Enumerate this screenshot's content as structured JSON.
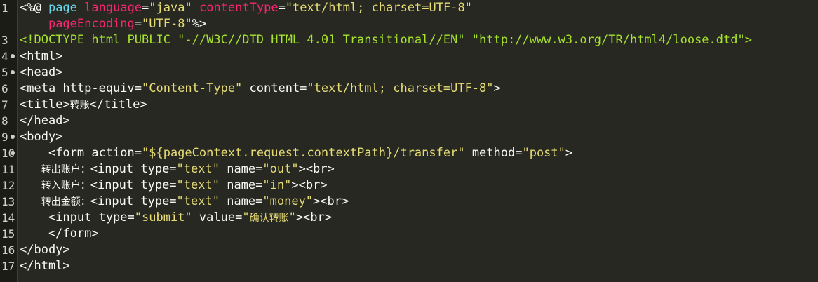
{
  "editor": {
    "colors": {
      "background": "#272822",
      "plain": "#f8f8f2",
      "directive": "#66d9ef",
      "attribute": "#f92672",
      "string": "#e6db74",
      "doctype": "#a6e22e",
      "gutter_text": "#d0d0c8"
    },
    "lines": [
      {
        "number": "1",
        "fold": false,
        "tokens": [
          {
            "text": "<%@ ",
            "kind": "plain"
          },
          {
            "text": "page",
            "kind": "directive"
          },
          {
            "text": " ",
            "kind": "plain"
          },
          {
            "text": "language",
            "kind": "attribute"
          },
          {
            "text": "=",
            "kind": "plain"
          },
          {
            "text": "\"java\"",
            "kind": "string"
          },
          {
            "text": " ",
            "kind": "plain"
          },
          {
            "text": "contentType",
            "kind": "attribute"
          },
          {
            "text": "=",
            "kind": "plain"
          },
          {
            "text": "\"text/html; charset=UTF-8\"",
            "kind": "string"
          }
        ]
      },
      {
        "number": "",
        "fold": false,
        "tokens": [
          {
            "text": "    ",
            "kind": "plain"
          },
          {
            "text": "pageEncoding",
            "kind": "attribute"
          },
          {
            "text": "=",
            "kind": "plain"
          },
          {
            "text": "\"UTF-8\"",
            "kind": "string"
          },
          {
            "text": "%>",
            "kind": "plain"
          }
        ]
      },
      {
        "number": "3",
        "fold": false,
        "tokens": [
          {
            "text": "<!DOCTYPE html PUBLIC \"-//W3C//DTD HTML 4.01 Transitional//EN\" \"http://www.w3.org/TR/html4/loose.dtd\">",
            "kind": "doctype"
          }
        ]
      },
      {
        "number": "4",
        "fold": true,
        "tokens": [
          {
            "text": "<html>",
            "kind": "plain"
          }
        ]
      },
      {
        "number": "5",
        "fold": true,
        "tokens": [
          {
            "text": "<head>",
            "kind": "plain"
          }
        ]
      },
      {
        "number": "6",
        "fold": false,
        "tokens": [
          {
            "text": "<meta http-equiv=",
            "kind": "plain"
          },
          {
            "text": "\"Content-Type\"",
            "kind": "string"
          },
          {
            "text": " content=",
            "kind": "plain"
          },
          {
            "text": "\"text/html; charset=UTF-8\"",
            "kind": "string"
          },
          {
            "text": ">",
            "kind": "plain"
          }
        ]
      },
      {
        "number": "7",
        "fold": false,
        "tokens": [
          {
            "text": "<title>",
            "kind": "plain"
          },
          {
            "text": "转账",
            "kind": "plain",
            "cjk": true
          },
          {
            "text": "</title>",
            "kind": "plain"
          }
        ]
      },
      {
        "number": "8",
        "fold": false,
        "tokens": [
          {
            "text": "</head>",
            "kind": "plain"
          }
        ]
      },
      {
        "number": "9",
        "fold": true,
        "tokens": [
          {
            "text": "<body>",
            "kind": "plain"
          }
        ]
      },
      {
        "number": "10",
        "fold": true,
        "tokens": [
          {
            "text": "    <form action=",
            "kind": "plain"
          },
          {
            "text": "\"${pageContext.request.contextPath}/transfer\"",
            "kind": "string"
          },
          {
            "text": " method=",
            "kind": "plain"
          },
          {
            "text": "\"post\"",
            "kind": "string"
          },
          {
            "text": ">",
            "kind": "plain"
          }
        ]
      },
      {
        "number": "11",
        "fold": false,
        "tokens": [
          {
            "text": "   ",
            "kind": "plain"
          },
          {
            "text": "转出账户：",
            "kind": "plain",
            "cjk": true
          },
          {
            "text": "<input type=",
            "kind": "plain"
          },
          {
            "text": "\"text\"",
            "kind": "string"
          },
          {
            "text": " name=",
            "kind": "plain"
          },
          {
            "text": "\"out\"",
            "kind": "string"
          },
          {
            "text": "><br>",
            "kind": "plain"
          }
        ]
      },
      {
        "number": "12",
        "fold": false,
        "tokens": [
          {
            "text": "   ",
            "kind": "plain"
          },
          {
            "text": "转入账户：",
            "kind": "plain",
            "cjk": true
          },
          {
            "text": "<input type=",
            "kind": "plain"
          },
          {
            "text": "\"text\"",
            "kind": "string"
          },
          {
            "text": " name=",
            "kind": "plain"
          },
          {
            "text": "\"in\"",
            "kind": "string"
          },
          {
            "text": "><br>",
            "kind": "plain"
          }
        ]
      },
      {
        "number": "13",
        "fold": false,
        "tokens": [
          {
            "text": "   ",
            "kind": "plain"
          },
          {
            "text": "转出金额：",
            "kind": "plain",
            "cjk": true
          },
          {
            "text": "<input type=",
            "kind": "plain"
          },
          {
            "text": "\"text\"",
            "kind": "string"
          },
          {
            "text": " name=",
            "kind": "plain"
          },
          {
            "text": "\"money\"",
            "kind": "string"
          },
          {
            "text": "><br>",
            "kind": "plain"
          }
        ]
      },
      {
        "number": "14",
        "fold": false,
        "tokens": [
          {
            "text": "    <input type=",
            "kind": "plain"
          },
          {
            "text": "\"submit\"",
            "kind": "string"
          },
          {
            "text": " value=",
            "kind": "plain"
          },
          {
            "text": "\"",
            "kind": "string"
          },
          {
            "text": "确认转账",
            "kind": "string",
            "cjk": true
          },
          {
            "text": "\"",
            "kind": "string"
          },
          {
            "text": "><br>",
            "kind": "plain"
          }
        ]
      },
      {
        "number": "15",
        "fold": false,
        "tokens": [
          {
            "text": "    </form>",
            "kind": "plain"
          }
        ]
      },
      {
        "number": "16",
        "fold": false,
        "tokens": [
          {
            "text": "</body>",
            "kind": "plain"
          }
        ]
      },
      {
        "number": "17",
        "fold": false,
        "tokens": [
          {
            "text": "</html>",
            "kind": "plain"
          }
        ]
      }
    ]
  }
}
